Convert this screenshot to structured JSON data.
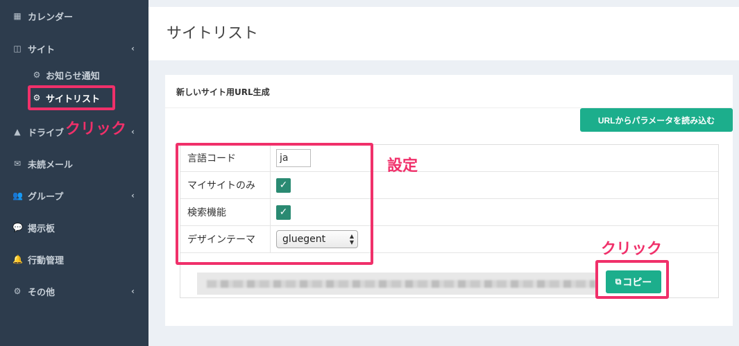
{
  "sidebar": {
    "items": [
      {
        "label": "カレンダー",
        "icon": "calendar-icon",
        "glyph": "▦"
      },
      {
        "label": "サイト",
        "icon": "columns-icon",
        "glyph": "◫",
        "chevron": "‹"
      },
      {
        "label": "お知らせ通知",
        "icon": "gears-icon",
        "glyph": "⚙"
      },
      {
        "label": "サイトリスト",
        "icon": "gears-icon",
        "glyph": "⚙"
      },
      {
        "label": "ドライブ",
        "icon": "drive-icon",
        "glyph": "▲",
        "chevron": "‹"
      },
      {
        "label": "未読メール",
        "icon": "envelope-icon",
        "glyph": "✉"
      },
      {
        "label": "グループ",
        "icon": "users-icon",
        "glyph": "👥",
        "chevron": "‹"
      },
      {
        "label": "掲示板",
        "icon": "comments-icon",
        "glyph": "💬"
      },
      {
        "label": "行動管理",
        "icon": "bell-icon",
        "glyph": "🔔"
      },
      {
        "label": "その他",
        "icon": "gears-icon",
        "glyph": "⚙",
        "chevron": "‹"
      }
    ]
  },
  "header": {
    "title": "サイトリスト"
  },
  "box": {
    "title": "新しいサイト用URL生成",
    "load_button": "URLからパラメータを読み込む",
    "settings": {
      "lang_label": "言語コード",
      "lang_value": "ja",
      "mysite_label": "マイサイトのみ",
      "mysite_checked": true,
      "search_label": "検索機能",
      "search_checked": true,
      "theme_label": "デザインテーマ",
      "theme_value": "gluegent"
    },
    "copy_button": "コピー",
    "check_glyph": "✓"
  },
  "annotations": {
    "click1": "クリック",
    "settings": "設定",
    "click2": "クリック",
    "color": "#f0306a"
  },
  "colors": {
    "sidebar_bg": "#2d3c4d",
    "accent_green": "#1cae8c",
    "checkbox_green": "#2a8a72"
  }
}
